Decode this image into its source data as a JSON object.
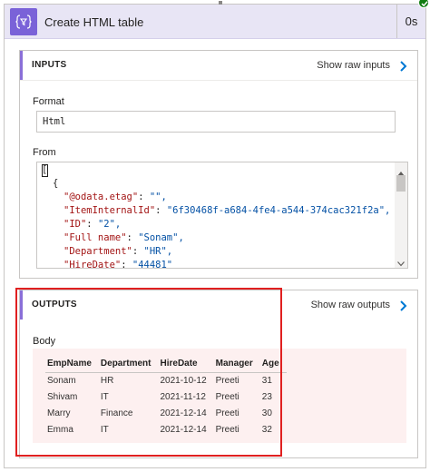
{
  "action": {
    "title": "Create HTML table",
    "duration": "0s",
    "icon": "data-operation-icon",
    "status_icon": "success-check-icon"
  },
  "inputs": {
    "section_title": "INPUTS",
    "raw_link": "Show raw inputs",
    "format_label": "Format",
    "format_value": "Html",
    "from_label": "From",
    "from_lines": [
      {
        "indent": 0,
        "key": "",
        "value": "["
      },
      {
        "indent": 1,
        "key": "",
        "value": "{"
      },
      {
        "indent": 2,
        "key": "\"@odata.etag\"",
        "value": "\"\","
      },
      {
        "indent": 2,
        "key": "\"ItemInternalId\"",
        "value": "\"6f30468f-a684-4fe4-a544-374cac321f2a\","
      },
      {
        "indent": 2,
        "key": "\"ID\"",
        "value": "\"2\","
      },
      {
        "indent": 2,
        "key": "\"Full name\"",
        "value": "\"Sonam\","
      },
      {
        "indent": 2,
        "key": "\"Department\"",
        "value": "\"HR\","
      },
      {
        "indent": 2,
        "key": "\"HireDate\"",
        "value": "\"44481\""
      }
    ]
  },
  "outputs": {
    "section_title": "OUTPUTS",
    "raw_link": "Show raw outputs",
    "body_label": "Body",
    "table": {
      "columns": [
        "EmpName",
        "Department",
        "HireDate",
        "Manager",
        "Age"
      ],
      "rows": [
        [
          "Sonam",
          "HR",
          "2021-10-12",
          "Preeti",
          "31"
        ],
        [
          "Shivam",
          "IT",
          "2021-11-12",
          "Preeti",
          "23"
        ],
        [
          "Marry",
          "Finance",
          "2021-12-14",
          "Preeti",
          "30"
        ],
        [
          "Emma",
          "IT",
          "2021-12-14",
          "Preeti",
          "32"
        ]
      ]
    }
  },
  "colors": {
    "header_bg": "#e8e5f5",
    "icon_bg": "#7a62d8",
    "accent": "#8a6fd8",
    "link_chevron": "#0078d4",
    "highlight": "#e02020",
    "table_bg": "#fdf0f0"
  }
}
